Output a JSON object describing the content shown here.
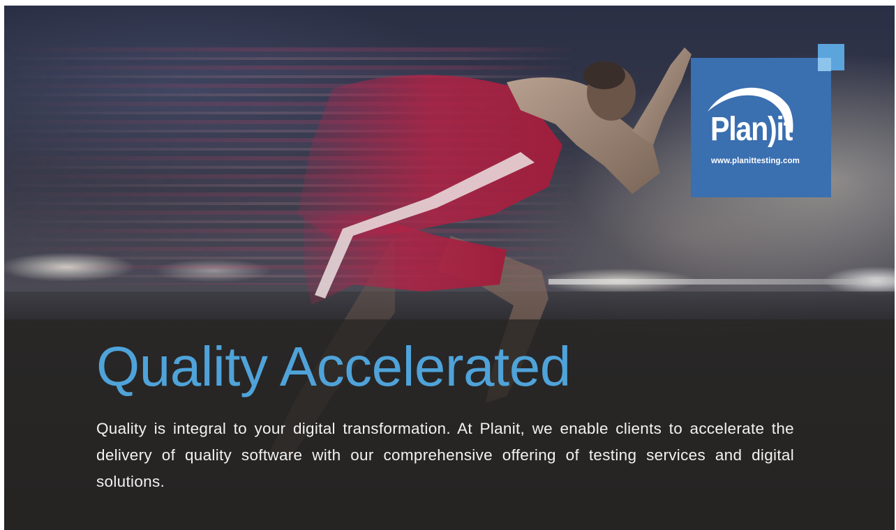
{
  "banner": {
    "headline": "Quality Accelerated",
    "body": "Quality is integral to your digital transformation. At Planit, we enable clients to accelerate the delivery of quality software with our comprehensive offering of testing services and digital solutions."
  },
  "logo": {
    "wordmark": "Plan)it",
    "url": "www.planittesting.com"
  },
  "colors": {
    "headline": "#4fa3d9",
    "logo_background": "#3a6fb0",
    "logo_accent": "#5ba4dc",
    "overlay": "#28262 4"
  },
  "icons": {
    "hero": "sprinter-photo",
    "logo_mark": "planit-arc-logo"
  }
}
